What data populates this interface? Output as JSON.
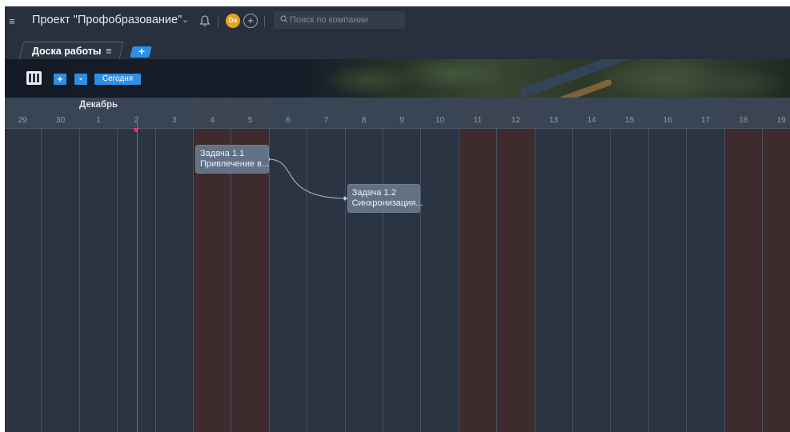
{
  "header": {
    "project_title": "Проект \"Профобразование\"",
    "avatar_initials": "Da",
    "search_placeholder": "Поиск по компании"
  },
  "tabs": [
    {
      "label": "Доска работы",
      "active": true
    }
  ],
  "toolbar": {
    "zoom_in": "+",
    "zoom_out": "-",
    "today": "Сегодня"
  },
  "timeline": {
    "month": "Декабрь",
    "days": [
      {
        "label": "29",
        "weekend": false
      },
      {
        "label": "30",
        "weekend": false
      },
      {
        "label": "1",
        "weekend": false
      },
      {
        "label": "2",
        "weekend": false
      },
      {
        "label": "3",
        "weekend": false
      },
      {
        "label": "4",
        "weekend": true
      },
      {
        "label": "5",
        "weekend": true
      },
      {
        "label": "6",
        "weekend": false
      },
      {
        "label": "7",
        "weekend": false
      },
      {
        "label": "8",
        "weekend": false
      },
      {
        "label": "9",
        "weekend": false
      },
      {
        "label": "10",
        "weekend": false
      },
      {
        "label": "11",
        "weekend": true
      },
      {
        "label": "12",
        "weekend": true
      },
      {
        "label": "13",
        "weekend": false
      },
      {
        "label": "14",
        "weekend": false
      },
      {
        "label": "15",
        "weekend": false
      },
      {
        "label": "16",
        "weekend": false
      },
      {
        "label": "17",
        "weekend": false
      },
      {
        "label": "18",
        "weekend": true
      },
      {
        "label": "19",
        "weekend": true
      }
    ],
    "today": "2"
  },
  "tasks": [
    {
      "id": "Задача 1.1",
      "title": "Привлечение в...",
      "start": "4",
      "end": "6"
    },
    {
      "id": "Задача 1.2",
      "title": "Синхронизация...",
      "start": "8",
      "end": "10"
    }
  ],
  "colors": {
    "accent": "#2f8fe3",
    "background": "#2b3442",
    "weekend": "#3d2b2d",
    "today_line": "#e23a6a",
    "task": "#627184"
  }
}
